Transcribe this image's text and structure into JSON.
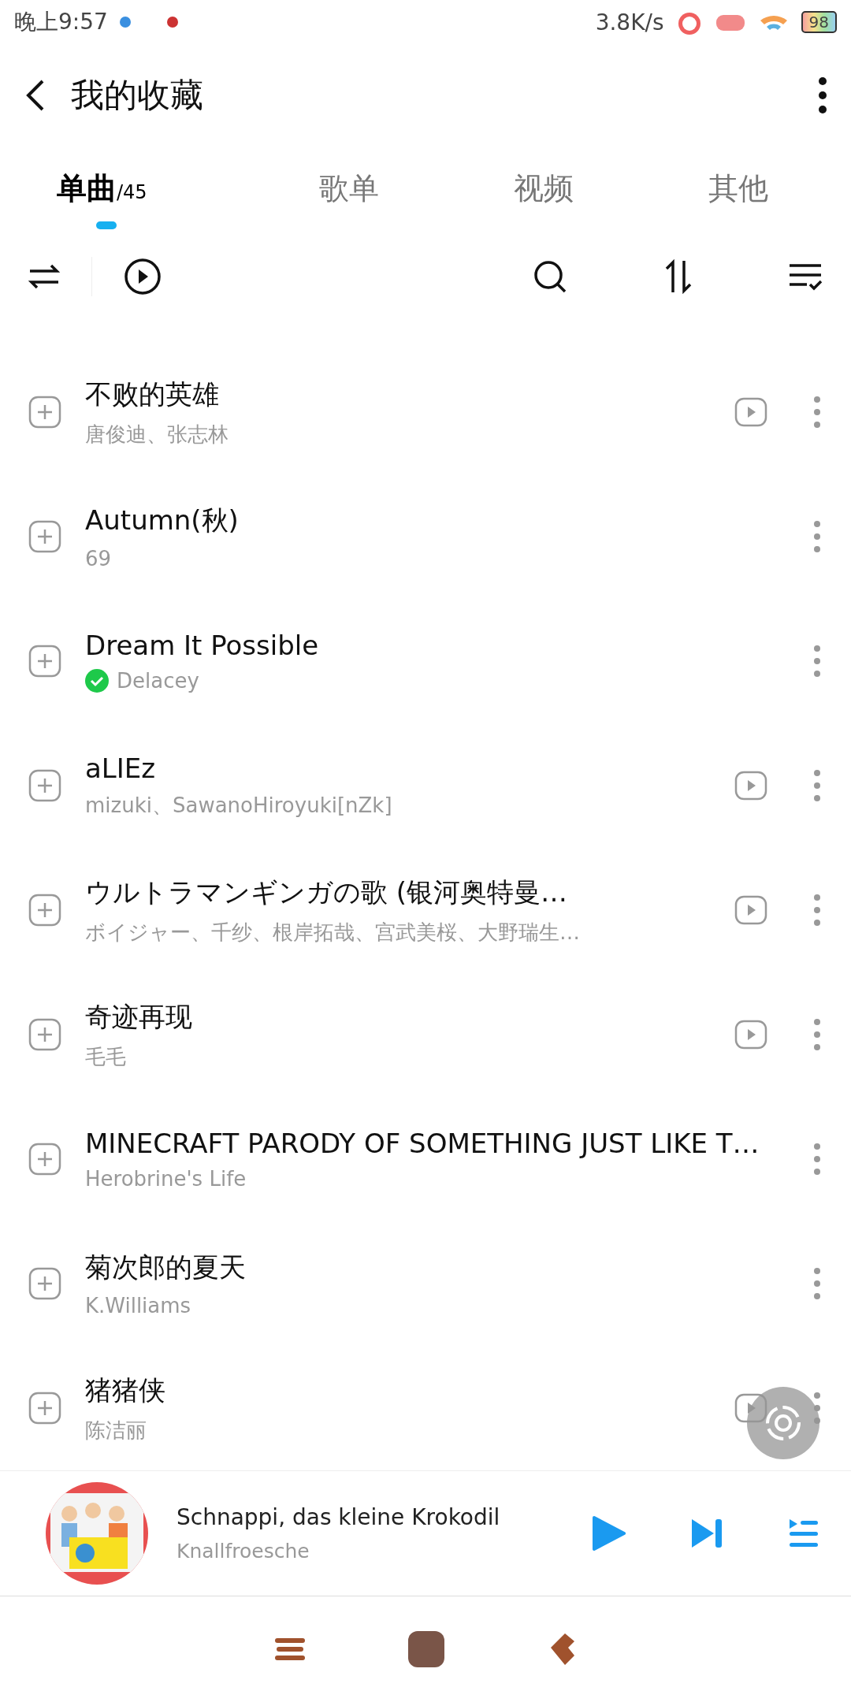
{
  "status_bar": {
    "time": "晚上9:57",
    "speed": "3.8K/s",
    "battery": "98"
  },
  "header": {
    "title": "我的收藏"
  },
  "tabs": [
    {
      "label": "单曲",
      "count": "/45",
      "selected": true
    },
    {
      "label": "歌单",
      "selected": false
    },
    {
      "label": "视频",
      "selected": false
    },
    {
      "label": "其他",
      "selected": false
    }
  ],
  "songs": [
    {
      "title": "不败的英雄",
      "artist": "唐俊迪、张志林",
      "has_video": true,
      "verified": false
    },
    {
      "title": "Autumn(秋)",
      "artist": "69",
      "has_video": false,
      "verified": false
    },
    {
      "title": "Dream It Possible",
      "artist": "Delacey",
      "has_video": false,
      "verified": true
    },
    {
      "title": "aLIEz",
      "artist": "mizuki、SawanoHiroyuki[nZk]",
      "has_video": true,
      "verified": false
    },
    {
      "title": "ウルトラマンギンガの歌 (银河奥特曼…",
      "artist": "ボイジャー、千纱、根岸拓哉、宫武美桜、大野瑞生…",
      "has_video": true,
      "verified": false
    },
    {
      "title": "奇迹再现",
      "artist": "毛毛",
      "has_video": true,
      "verified": false
    },
    {
      "title": "MINECRAFT PARODY OF SOMETHING JUST LIKE T…",
      "artist": "Herobrine's Life",
      "has_video": false,
      "verified": false
    },
    {
      "title": "菊次郎的夏天",
      "artist": "K.Williams",
      "has_video": false,
      "verified": false
    },
    {
      "title": "猪猪侠",
      "artist": "陈洁丽",
      "has_video": true,
      "verified": false
    }
  ],
  "now_playing": {
    "title": "Schnappi, das kleine Krokodil",
    "artist": "Knallfroesche"
  }
}
